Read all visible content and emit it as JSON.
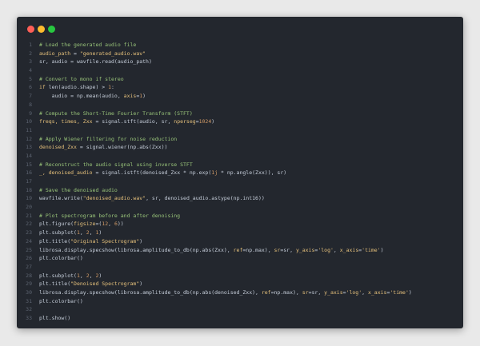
{
  "window": {
    "controls": [
      {
        "name": "close",
        "color": "#ff5f57"
      },
      {
        "name": "minimize",
        "color": "#febc2e"
      },
      {
        "name": "zoom",
        "color": "#28c840"
      }
    ]
  },
  "code": {
    "lines": [
      {
        "n": "1",
        "tokens": [
          {
            "t": "# Load the generated audio file",
            "k": "comment"
          }
        ]
      },
      {
        "n": "2",
        "tokens": [
          {
            "t": "audio_path",
            "k": "var"
          },
          {
            "t": " = ",
            "k": "plain"
          },
          {
            "t": "\"generated_audio.wav\"",
            "k": "string"
          }
        ]
      },
      {
        "n": "3",
        "tokens": [
          {
            "t": "sr, audio = wavfile.read(audio_path)",
            "k": "plain"
          }
        ]
      },
      {
        "n": "4",
        "tokens": []
      },
      {
        "n": "5",
        "tokens": [
          {
            "t": "# Convert to mono if stereo",
            "k": "comment"
          }
        ]
      },
      {
        "n": "6",
        "tokens": [
          {
            "t": "if",
            "k": "keyword"
          },
          {
            "t": " len(audio.shape) > ",
            "k": "plain"
          },
          {
            "t": "1",
            "k": "number"
          },
          {
            "t": ":",
            "k": "plain"
          }
        ]
      },
      {
        "n": "7",
        "tokens": [
          {
            "t": "    audio = np.mean(audio, ",
            "k": "plain"
          },
          {
            "t": "axis",
            "k": "kwarg"
          },
          {
            "t": "=",
            "k": "plain"
          },
          {
            "t": "1",
            "k": "number"
          },
          {
            "t": ")",
            "k": "plain"
          }
        ]
      },
      {
        "n": "8",
        "tokens": []
      },
      {
        "n": "9",
        "tokens": [
          {
            "t": "# Compute the Short-Time Fourier Transform (STFT)",
            "k": "comment"
          }
        ]
      },
      {
        "n": "10",
        "tokens": [
          {
            "t": "freqs, times, Zxx",
            "k": "var"
          },
          {
            "t": " = signal.stft(audio, sr, ",
            "k": "plain"
          },
          {
            "t": "nperseg",
            "k": "kwarg"
          },
          {
            "t": "=",
            "k": "plain"
          },
          {
            "t": "1024",
            "k": "number"
          },
          {
            "t": ")",
            "k": "plain"
          }
        ]
      },
      {
        "n": "11",
        "tokens": []
      },
      {
        "n": "12",
        "tokens": [
          {
            "t": "# Apply Wiener filtering for noise reduction",
            "k": "comment"
          }
        ]
      },
      {
        "n": "13",
        "tokens": [
          {
            "t": "denoised_Zxx",
            "k": "var"
          },
          {
            "t": " = signal.wiener(np.abs(Zxx))",
            "k": "plain"
          }
        ]
      },
      {
        "n": "14",
        "tokens": []
      },
      {
        "n": "15",
        "tokens": [
          {
            "t": "# Reconstruct the audio signal using inverse STFT",
            "k": "comment"
          }
        ]
      },
      {
        "n": "16",
        "tokens": [
          {
            "t": "_, denoised_audio",
            "k": "var"
          },
          {
            "t": " = signal.istft(denoised_Zxx * np.exp(",
            "k": "plain"
          },
          {
            "t": "1j",
            "k": "number"
          },
          {
            "t": " * np.angle(Zxx)), sr)",
            "k": "plain"
          }
        ]
      },
      {
        "n": "17",
        "tokens": []
      },
      {
        "n": "18",
        "tokens": [
          {
            "t": "# Save the denoised audio",
            "k": "comment"
          }
        ]
      },
      {
        "n": "19",
        "tokens": [
          {
            "t": "wavfile.write(",
            "k": "plain"
          },
          {
            "t": "\"denoised_audio.wav\"",
            "k": "string"
          },
          {
            "t": ", sr, denoised_audio.astype(np.int16))",
            "k": "plain"
          }
        ]
      },
      {
        "n": "20",
        "tokens": []
      },
      {
        "n": "21",
        "tokens": [
          {
            "t": "# Plot spectrogram before and after denoising",
            "k": "comment"
          }
        ]
      },
      {
        "n": "22",
        "tokens": [
          {
            "t": "plt.figure(",
            "k": "plain"
          },
          {
            "t": "figsize",
            "k": "kwarg"
          },
          {
            "t": "=(",
            "k": "plain"
          },
          {
            "t": "12",
            "k": "number"
          },
          {
            "t": ", ",
            "k": "plain"
          },
          {
            "t": "6",
            "k": "number"
          },
          {
            "t": "))",
            "k": "plain"
          }
        ]
      },
      {
        "n": "23",
        "tokens": [
          {
            "t": "plt.subplot(",
            "k": "plain"
          },
          {
            "t": "1",
            "k": "number"
          },
          {
            "t": ", ",
            "k": "plain"
          },
          {
            "t": "2",
            "k": "number"
          },
          {
            "t": ", ",
            "k": "plain"
          },
          {
            "t": "1",
            "k": "number"
          },
          {
            "t": ")",
            "k": "plain"
          }
        ]
      },
      {
        "n": "24",
        "tokens": [
          {
            "t": "plt.title(",
            "k": "plain"
          },
          {
            "t": "\"Original Spectrogram\"",
            "k": "string"
          },
          {
            "t": ")",
            "k": "plain"
          }
        ]
      },
      {
        "n": "25",
        "tokens": [
          {
            "t": "librosa.display.specshow(librosa.amplitude_to_db(np.abs(Zxx), ",
            "k": "plain"
          },
          {
            "t": "ref",
            "k": "kwarg"
          },
          {
            "t": "=np.max), ",
            "k": "plain"
          },
          {
            "t": "sr",
            "k": "kwarg"
          },
          {
            "t": "=sr, ",
            "k": "plain"
          },
          {
            "t": "y_axis",
            "k": "kwarg"
          },
          {
            "t": "=",
            "k": "plain"
          },
          {
            "t": "'log'",
            "k": "string"
          },
          {
            "t": ", ",
            "k": "plain"
          },
          {
            "t": "x_axis",
            "k": "kwarg"
          },
          {
            "t": "=",
            "k": "plain"
          },
          {
            "t": "'time'",
            "k": "string"
          },
          {
            "t": ")",
            "k": "plain"
          }
        ]
      },
      {
        "n": "26",
        "tokens": [
          {
            "t": "plt.colorbar()",
            "k": "plain"
          }
        ]
      },
      {
        "n": "27",
        "tokens": []
      },
      {
        "n": "28",
        "tokens": [
          {
            "t": "plt.subplot(",
            "k": "plain"
          },
          {
            "t": "1",
            "k": "number"
          },
          {
            "t": ", ",
            "k": "plain"
          },
          {
            "t": "2",
            "k": "number"
          },
          {
            "t": ", ",
            "k": "plain"
          },
          {
            "t": "2",
            "k": "number"
          },
          {
            "t": ")",
            "k": "plain"
          }
        ]
      },
      {
        "n": "29",
        "tokens": [
          {
            "t": "plt.title(",
            "k": "plain"
          },
          {
            "t": "\"Denoised Spectrogram\"",
            "k": "string"
          },
          {
            "t": ")",
            "k": "plain"
          }
        ]
      },
      {
        "n": "30",
        "tokens": [
          {
            "t": "librosa.display.specshow(librosa.amplitude_to_db(np.abs(denoised_Zxx), ",
            "k": "plain"
          },
          {
            "t": "ref",
            "k": "kwarg"
          },
          {
            "t": "=np.max), ",
            "k": "plain"
          },
          {
            "t": "sr",
            "k": "kwarg"
          },
          {
            "t": "=sr, ",
            "k": "plain"
          },
          {
            "t": "y_axis",
            "k": "kwarg"
          },
          {
            "t": "=",
            "k": "plain"
          },
          {
            "t": "'log'",
            "k": "string"
          },
          {
            "t": ", ",
            "k": "plain"
          },
          {
            "t": "x_axis",
            "k": "kwarg"
          },
          {
            "t": "=",
            "k": "plain"
          },
          {
            "t": "'time'",
            "k": "string"
          },
          {
            "t": ")",
            "k": "plain"
          }
        ]
      },
      {
        "n": "31",
        "tokens": [
          {
            "t": "plt.colorbar()",
            "k": "plain"
          }
        ]
      },
      {
        "n": "32",
        "tokens": []
      },
      {
        "n": "33",
        "tokens": [
          {
            "t": "plt.show()",
            "k": "plain"
          }
        ]
      }
    ]
  }
}
